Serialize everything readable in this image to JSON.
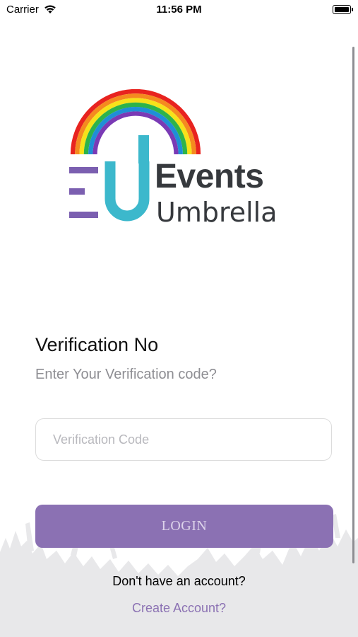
{
  "status_bar": {
    "carrier": "Carrier",
    "time": "11:56 PM"
  },
  "logo": {
    "line1": "Events",
    "line2": "Umbrella",
    "rainbow_colors": [
      "#e8231f",
      "#f58a1f",
      "#f6e21a",
      "#2db34a",
      "#1f8fd6",
      "#7a3ab5"
    ],
    "u_color": "#3cb8cc",
    "bar_color": "#7b5fb0"
  },
  "verification": {
    "title": "Verification No",
    "subtitle": "Enter Your Verification code?",
    "input_placeholder": "Verification Code",
    "input_value": ""
  },
  "actions": {
    "login_label": "LOGIN",
    "no_account_text": "Don't have an account?",
    "create_account_label": "Create Account?"
  },
  "colors": {
    "accent": "#8b71b3",
    "crowd": "#e8e8ea"
  }
}
